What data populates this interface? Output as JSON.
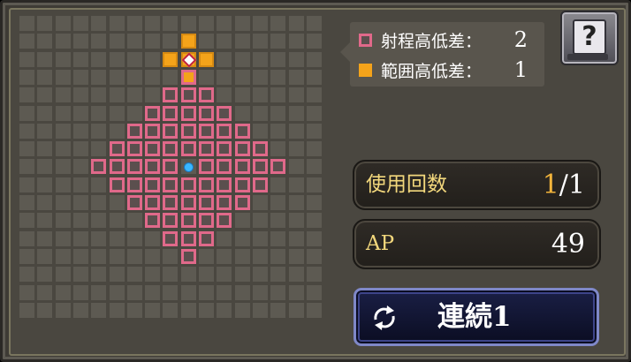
{
  "legend": {
    "range_label": "射程高低差：",
    "range_value": "2",
    "area_label": "範囲高低差：",
    "area_value": "1",
    "range_color": "#e0698a",
    "area_color": "#f4a31a"
  },
  "help": {
    "icon": "help-book-icon",
    "glyph": "?"
  },
  "usage": {
    "label": "使用回数",
    "current": "1",
    "max": "/1"
  },
  "ap": {
    "label": "AP",
    "value": "49"
  },
  "chain_button": {
    "icon": "cycle-arrows-icon",
    "label": "連続1"
  },
  "grid": {
    "size": 17,
    "range_cells": [
      [
        8,
        4
      ],
      [
        9,
        4
      ],
      [
        10,
        4
      ],
      [
        7,
        5
      ],
      [
        8,
        5
      ],
      [
        9,
        5
      ],
      [
        10,
        5
      ],
      [
        11,
        5
      ],
      [
        6,
        6
      ],
      [
        7,
        6
      ],
      [
        8,
        6
      ],
      [
        9,
        6
      ],
      [
        10,
        6
      ],
      [
        11,
        6
      ],
      [
        12,
        6
      ],
      [
        5,
        7
      ],
      [
        6,
        7
      ],
      [
        7,
        7
      ],
      [
        8,
        7
      ],
      [
        9,
        7
      ],
      [
        10,
        7
      ],
      [
        11,
        7
      ],
      [
        12,
        7
      ],
      [
        13,
        7
      ],
      [
        4,
        8
      ],
      [
        5,
        8
      ],
      [
        6,
        8
      ],
      [
        7,
        8
      ],
      [
        8,
        8
      ],
      [
        10,
        8
      ],
      [
        11,
        8
      ],
      [
        12,
        8
      ],
      [
        13,
        8
      ],
      [
        14,
        8
      ],
      [
        5,
        9
      ],
      [
        6,
        9
      ],
      [
        7,
        9
      ],
      [
        8,
        9
      ],
      [
        9,
        9
      ],
      [
        10,
        9
      ],
      [
        11,
        9
      ],
      [
        12,
        9
      ],
      [
        13,
        9
      ],
      [
        6,
        10
      ],
      [
        7,
        10
      ],
      [
        8,
        10
      ],
      [
        9,
        10
      ],
      [
        10,
        10
      ],
      [
        11,
        10
      ],
      [
        12,
        10
      ],
      [
        7,
        11
      ],
      [
        8,
        11
      ],
      [
        9,
        11
      ],
      [
        10,
        11
      ],
      [
        11,
        11
      ],
      [
        8,
        12
      ],
      [
        9,
        12
      ],
      [
        10,
        12
      ],
      [
        9,
        13
      ]
    ],
    "range_small_area_cells": [
      [
        9,
        3
      ]
    ],
    "area_cells": [
      [
        9,
        1
      ],
      [
        8,
        2
      ],
      [
        9,
        2
      ],
      [
        10,
        2
      ]
    ],
    "target_cell": [
      9,
      2
    ],
    "player_cell": [
      9,
      8
    ]
  }
}
